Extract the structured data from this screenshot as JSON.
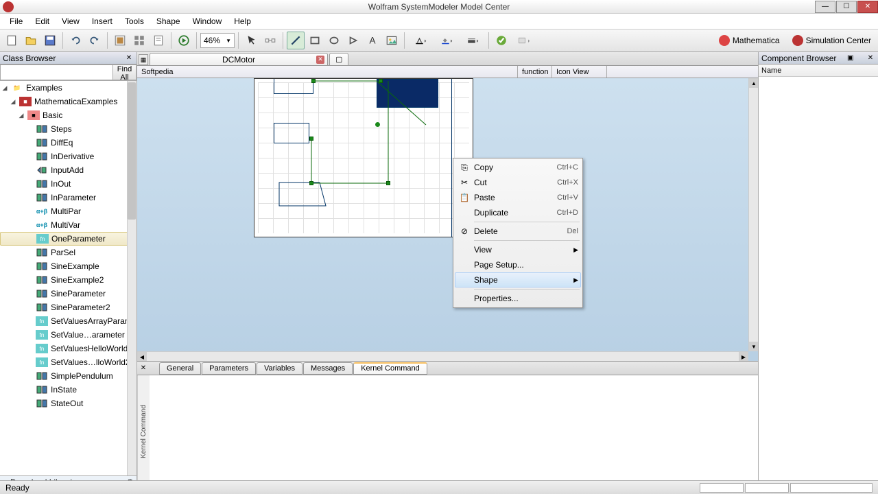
{
  "app": {
    "title": "Wolfram SystemModeler Model Center"
  },
  "menu": {
    "items": [
      "File",
      "Edit",
      "View",
      "Insert",
      "Tools",
      "Shape",
      "Window",
      "Help"
    ]
  },
  "toolbar": {
    "zoom": "46%",
    "right": {
      "mathematica": "Mathematica",
      "simcenter": "Simulation Center"
    }
  },
  "classBrowser": {
    "title": "Class Browser",
    "findAll": "Find All",
    "root": "Examples",
    "level1": "MathematicaExamples",
    "level2": "Basic",
    "items": [
      "Steps",
      "DiffEq",
      "InDerivative",
      "InputAdd",
      "InOut",
      "InParameter",
      "MultiPar",
      "MultiVar",
      "OneParameter",
      "ParSel",
      "SineExample",
      "SineExample2",
      "SineParameter",
      "SineParameter2",
      "SetValuesArrayParam",
      "SetValue…arameter",
      "SetValuesHelloWorld",
      "SetValues…lloWorld2",
      "SimplePendulum",
      "InState",
      "StateOut"
    ],
    "selected": "OneParameter",
    "footer": "Download Libraries"
  },
  "tabs": {
    "main": "DCMotor"
  },
  "docinfo": {
    "path": "Softpedia",
    "kind": "function",
    "view": "Icon View"
  },
  "bottomTabs": {
    "items": [
      "General",
      "Parameters",
      "Variables",
      "Messages",
      "Kernel Command"
    ],
    "active": "Kernel Command",
    "sideLabel": "Kernel Command"
  },
  "componentBrowser": {
    "title": "Component Browser",
    "col": "Name"
  },
  "context": {
    "items": [
      {
        "label": "Copy",
        "short": "Ctrl+C",
        "icon": "copy"
      },
      {
        "label": "Cut",
        "short": "Ctrl+X",
        "icon": "cut"
      },
      {
        "label": "Paste",
        "short": "Ctrl+V",
        "icon": "paste"
      },
      {
        "label": "Duplicate",
        "short": "Ctrl+D"
      },
      {
        "sep": true
      },
      {
        "label": "Delete",
        "short": "Del",
        "icon": "delete"
      },
      {
        "sep": true
      },
      {
        "label": "View",
        "arrow": true
      },
      {
        "label": "Page Setup..."
      },
      {
        "label": "Shape",
        "arrow": true,
        "hover": true
      },
      {
        "sep": true
      },
      {
        "label": "Properties..."
      }
    ]
  },
  "status": {
    "text": "Ready"
  }
}
